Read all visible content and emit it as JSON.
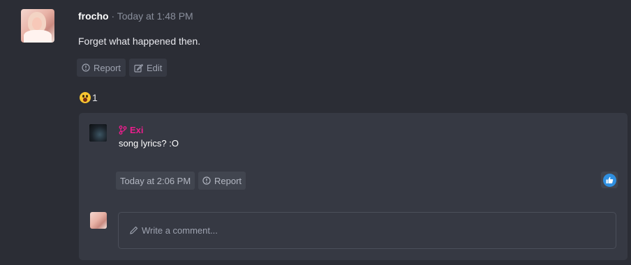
{
  "post": {
    "author": "frocho",
    "separator": " · ",
    "time": "Today at 1:48 PM",
    "message": "Forget what happened then.",
    "actions": {
      "report": "Report",
      "edit": "Edit"
    },
    "reaction": {
      "emoji": "astonished-face",
      "count": "1"
    }
  },
  "comment": {
    "author": "Exi",
    "author_color": "#e91e8c",
    "text": "song lyrics? :O",
    "time": "Today at 2:06 PM",
    "report": "Report",
    "like_color": "#2f8fe0"
  },
  "composer": {
    "placeholder": "Write a comment..."
  }
}
